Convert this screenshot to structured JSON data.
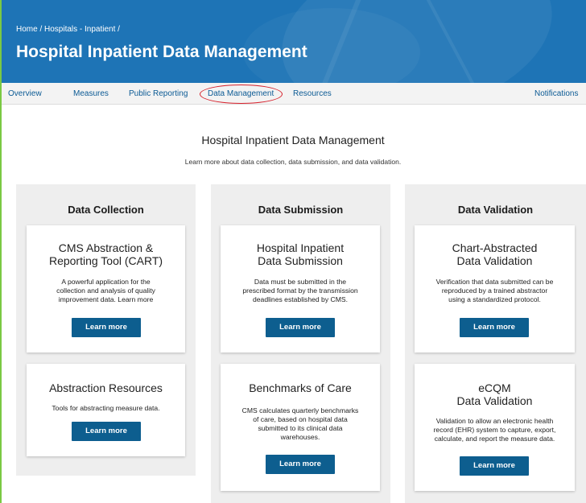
{
  "header": {
    "breadcrumb": "Home / Hospitals - Inpatient /",
    "title": "Hospital Inpatient Data Management"
  },
  "nav": {
    "items": [
      {
        "label": "Overview"
      },
      {
        "label": "Measures"
      },
      {
        "label": "Public Reporting"
      },
      {
        "label": "Data Management",
        "highlighted": true
      },
      {
        "label": "Resources"
      }
    ],
    "notifications_label": "Notifications",
    "highlight_color": "#d6202b"
  },
  "main": {
    "heading": "Hospital Inpatient Data Management",
    "subheading": "Learn more about data collection, data submission, and data validation."
  },
  "colors": {
    "hero_blue": "#1e74b6",
    "button_blue": "#0d5e8f",
    "link_blue": "#0b5a94",
    "column_gray": "#eeeeee"
  },
  "columns": [
    {
      "title": "Data Collection",
      "cards": [
        {
          "title_lines": [
            "CMS Abstraction &",
            "Reporting Tool (CART)"
          ],
          "desc_lines": [
            "A powerful application for the",
            "collection and analysis of quality",
            "improvement data. Learn more"
          ],
          "button": "Learn more"
        },
        {
          "title_lines": [
            "Abstraction Resources"
          ],
          "desc_lines": [
            "Tools for abstracting measure data."
          ],
          "button": "Learn more"
        }
      ]
    },
    {
      "title": "Data Submission",
      "cards": [
        {
          "title_lines": [
            "Hospital Inpatient",
            "Data Submission"
          ],
          "desc_lines": [
            "Data must be submitted in the",
            "prescribed format by the transmission",
            "deadlines established by CMS."
          ],
          "button": "Learn more"
        },
        {
          "title_lines": [
            "Benchmarks of Care"
          ],
          "desc_lines": [
            "CMS calculates quarterly benchmarks",
            "of care, based on hospital data",
            "submitted to its clinical data",
            "warehouses."
          ],
          "button": "Learn more"
        }
      ]
    },
    {
      "title": "Data Validation",
      "cards": [
        {
          "title_lines": [
            "Chart-Abstracted",
            "Data Validation"
          ],
          "desc_lines": [
            "Verification that data submitted can be",
            "reproduced by a trained abstractor",
            "using a standardized protocol."
          ],
          "button": "Learn more"
        },
        {
          "title_lines": [
            "eCQM",
            "Data Validation"
          ],
          "desc_lines": [
            "Validation to allow an electronic health",
            "record (EHR) system to capture, export,",
            "calculate, and report the measure data."
          ],
          "button": "Learn more"
        }
      ]
    }
  ]
}
